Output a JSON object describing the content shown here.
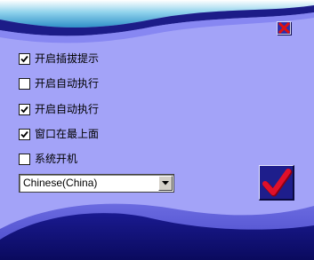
{
  "options": [
    {
      "label": "开启插拔提示",
      "checked": true
    },
    {
      "label": "开启自动执行",
      "checked": false
    },
    {
      "label": "开启自动执行",
      "checked": true
    },
    {
      "label": "窗口在最上面",
      "checked": true
    },
    {
      "label": "系统开机",
      "checked": false
    }
  ],
  "language": {
    "selected": "Chinese(China)"
  },
  "icons": {
    "close": "close-x-icon",
    "ok": "red-checkmark-icon",
    "dropdown": "dropdown-arrow-icon"
  },
  "colors": {
    "panel": "#a3a3f8",
    "wave_dark": "#14147a",
    "close_x": "#e01010",
    "checkmark": "#e0102a"
  }
}
